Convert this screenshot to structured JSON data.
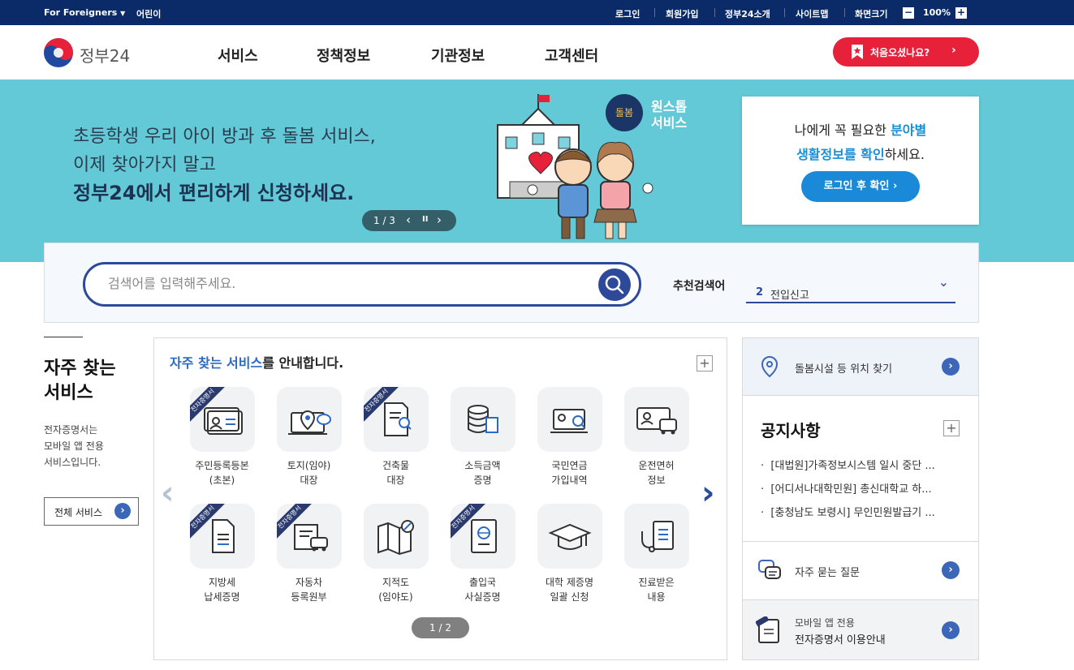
{
  "topbar": {
    "for_foreigners": "For Foreigners",
    "kids": "어린이",
    "login": "로그인",
    "signup": "회원가입",
    "about": "정부24소개",
    "sitemap": "사이트맵",
    "screen_size": "화면크기",
    "zoom_minus": "−",
    "zoom_value": "100%",
    "zoom_plus": "+"
  },
  "header": {
    "logo_text": "정부24",
    "nav": [
      "서비스",
      "정책정보",
      "기관정보",
      "고객센터"
    ],
    "first_visit": "처음오셨나요?"
  },
  "hero": {
    "line1": "초등학생 우리 아이 방과 후 돌봄 서비스,",
    "line2": "이제 찾아가지 말고",
    "line3": "정부24에서 편리하게 신청하세요.",
    "pager": "1 / 3",
    "badge_text": "돌봄",
    "badge_title_1": "원스톱",
    "badge_title_2": "서비스",
    "card": {
      "line1_a": "나에게 꼭 필요한 ",
      "line1_b": "분야별",
      "line2_a": "생활정보를 확인",
      "line2_b": "하세요.",
      "button": "로그인 후 확인"
    }
  },
  "search": {
    "placeholder": "검색어를 입력해주세요.",
    "recommend_label": "추천검색어",
    "recommend_rank": "2",
    "recommend_term": "전입신고"
  },
  "frequent": {
    "title_line1": "자주 찾는",
    "title_line2": "서비스",
    "desc_line1": "전자증명서는",
    "desc_line2": "모바일 앱 전용",
    "desc_line3": "서비스입니다.",
    "all_button": "전체 서비스"
  },
  "services": {
    "heading_a": "자주 찾는 서비스",
    "heading_b": "를 안내합니다.",
    "ribbon": "전자증명서",
    "page": "1 / 2",
    "items": [
      {
        "l1": "주민등록등본",
        "l2": "(초본)"
      },
      {
        "l1": "토지(임야)",
        "l2": "대장"
      },
      {
        "l1": "건축물",
        "l2": "대장"
      },
      {
        "l1": "소득금액",
        "l2": "증명"
      },
      {
        "l1": "국민연금",
        "l2": "가입내역"
      },
      {
        "l1": "운전면허",
        "l2": "정보"
      },
      {
        "l1": "지방세",
        "l2": "납세증명"
      },
      {
        "l1": "자동차",
        "l2": "등록원부"
      },
      {
        "l1": "지적도",
        "l2": "(임야도)"
      },
      {
        "l1": "출입국",
        "l2": "사실증명"
      },
      {
        "l1": "대학 제증명",
        "l2": "일괄 신청"
      },
      {
        "l1": "진료받은",
        "l2": "내용"
      }
    ]
  },
  "right": {
    "care_locator": "돌봄시설 등 위치 찾기",
    "notice_title": "공지사항",
    "notices": [
      "[대법원]가족정보시스템 일시 중단 ...",
      "[어디서나대학민원] 총신대학교 하...",
      "[충청남도 보령시] 무인민원발급기 ..."
    ],
    "faq": "자주 묻는 질문",
    "mobile_small": "모바일 앱 전용",
    "mobile_main": "전자증명서 이용안내"
  },
  "colors": {
    "navy": "#0a2b68",
    "hero_bg": "#63c9d7",
    "accent_blue": "#2d4a9a",
    "red": "#e8213a"
  }
}
